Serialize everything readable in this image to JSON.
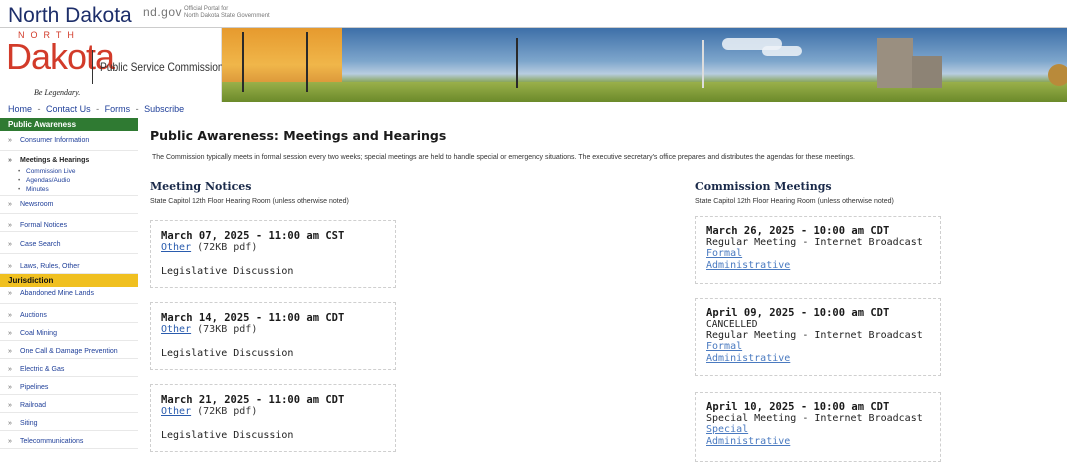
{
  "header": {
    "state_name": "North Dakota",
    "ndgov": "nd.gov",
    "portal_line1": "Official Portal for",
    "portal_line2": "North Dakota State Government"
  },
  "logo": {
    "north": "NORTH",
    "dakota": "Dakota",
    "agency": "Public Service Commission",
    "tagline": "Be Legendary."
  },
  "nav": {
    "home": "Home",
    "contact": "Contact Us",
    "forms": "Forms",
    "subscribe": "Subscribe",
    "separator": "-"
  },
  "sidebar": {
    "public_awareness": "Public Awareness",
    "items_pa": [
      {
        "label": "Consumer Information"
      },
      {
        "label": "Meetings & Hearings"
      },
      {
        "label": "Newsroom"
      },
      {
        "label": "Formal Notices"
      },
      {
        "label": "Case Search"
      },
      {
        "label": "Laws, Rules, Other"
      }
    ],
    "sub_meetings": [
      {
        "label": "Commission Live"
      },
      {
        "label": "Agendas/Audio"
      },
      {
        "label": "Minutes"
      }
    ],
    "jurisdiction": "Jurisdiction",
    "items_j": [
      {
        "label": "Abandoned Mine Lands"
      },
      {
        "label": "Auctions"
      },
      {
        "label": "Coal Mining"
      },
      {
        "label": "One Call & Damage Prevention"
      },
      {
        "label": "Electric & Gas"
      },
      {
        "label": "Pipelines"
      },
      {
        "label": "Railroad"
      },
      {
        "label": "Siting"
      },
      {
        "label": "Telecommunications"
      }
    ]
  },
  "main": {
    "title": "Public Awareness: Meetings and Hearings",
    "intro": "The Commission typically meets in formal session every two weeks; special meetings are held to handle special or emergency situations. The executive secretary's office prepares and distributes the agendas for these meetings."
  },
  "notices": {
    "title": "Meeting Notices",
    "location": "State Capitol 12th Floor Hearing Room (unless otherwise noted)",
    "items": [
      {
        "date": "March 07, 2025 - 11:00 am CST",
        "doc": "Other",
        "size": "(72KB pdf)",
        "desc": "Legislative Discussion"
      },
      {
        "date": "March 14, 2025 - 11:00 am CDT",
        "doc": "Other",
        "size": "(73KB pdf)",
        "desc": "Legislative Discussion"
      },
      {
        "date": "March 21, 2025 - 11:00 am CDT",
        "doc": "Other",
        "size": "(72KB pdf)",
        "desc": "Legislative Discussion"
      }
    ]
  },
  "commission": {
    "title": "Commission Meetings",
    "location": "State Capitol 12th Floor Hearing Room (unless otherwise noted)",
    "items": [
      {
        "date": "March 26, 2025 - 10:00 am CDT",
        "status": "",
        "type": "Regular Meeting - Internet Broadcast",
        "link1": "Formal",
        "link2": "Administrative"
      },
      {
        "date": "April 09, 2025 - 10:00 am CDT",
        "status": "CANCELLED",
        "type": "Regular Meeting - Internet Broadcast",
        "link1": "Formal",
        "link2": "Administrative"
      },
      {
        "date": "April 10, 2025 - 10:00 am CDT",
        "status": "",
        "type": "Special Meeting - Internet Broadcast",
        "link1": "Special",
        "link2": "Administrative"
      }
    ]
  },
  "colors": {
    "accent_green": "#2f7a32",
    "accent_yellow": "#f0c020",
    "link_blue": "#1f3f99",
    "logo_red": "#d23b2a"
  }
}
